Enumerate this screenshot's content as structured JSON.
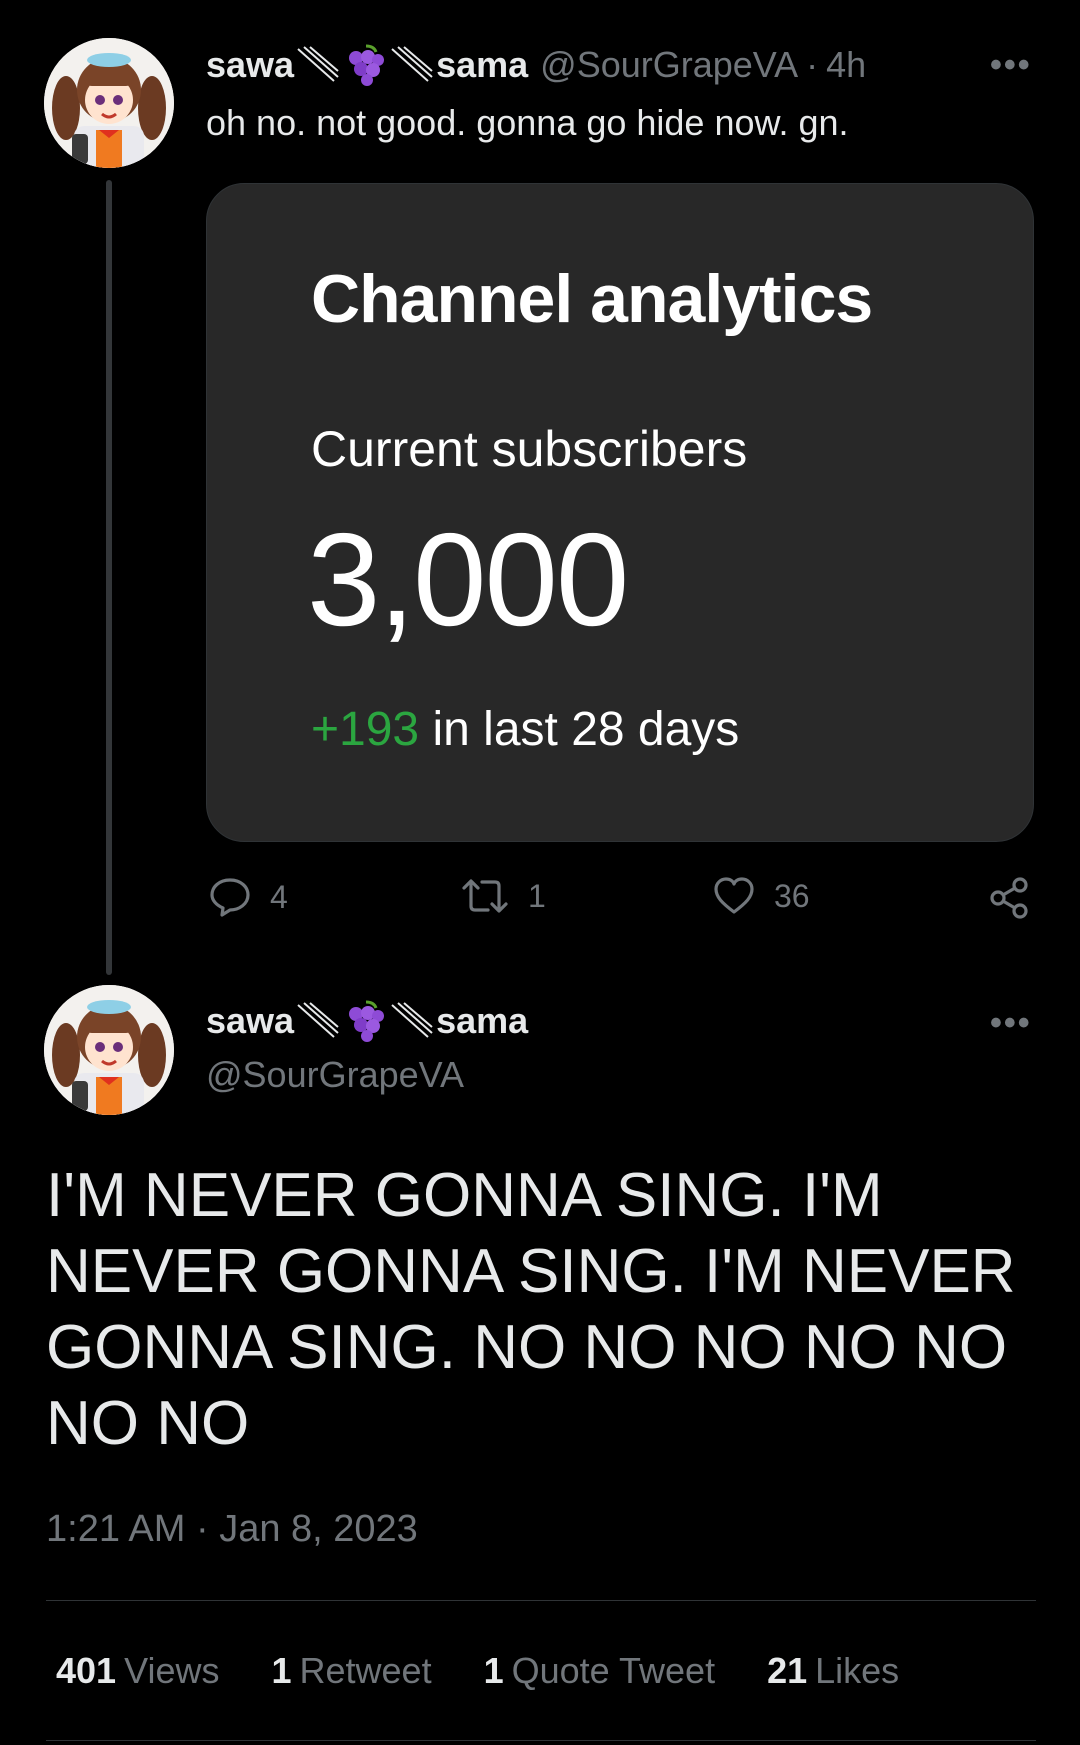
{
  "tweet1": {
    "name_left": "sawa",
    "name_right": "sama",
    "handle": "@SourGrapeVA",
    "separator": "·",
    "time_ago": "4h",
    "more": "•••",
    "text": "oh no. not good. gonna go hide now. gn.",
    "media": {
      "title": "Channel analytics",
      "subtitle": "Current subscribers",
      "count": "3,000",
      "delta": "+193",
      "delta_suffix": " in last 28 days"
    },
    "actions": {
      "replies": "4",
      "retweets": "1",
      "likes": "36"
    }
  },
  "tweet2": {
    "name_left": "sawa",
    "name_right": "sama",
    "handle": "@SourGrapeVA",
    "more": "•••",
    "text": "I'M NEVER GONNA SING. I'M NEVER GONNA SING. I'M NEVER GONNA SING. NO NO NO NO NO NO NO",
    "timestamp": "1:21 AM · Jan 8, 2023",
    "stats": [
      {
        "num": "401",
        "label": "Views"
      },
      {
        "num": "1",
        "label": "Retweet"
      },
      {
        "num": "1",
        "label": "Quote Tweet"
      },
      {
        "num": "21",
        "label": "Likes"
      }
    ]
  },
  "colors": {
    "background": "#000000",
    "text": "#e7e9ea",
    "muted": "#71767b",
    "grape": "#8e4bd6",
    "positive": "#2ba640"
  },
  "icons": [
    "reply-icon",
    "retweet-icon",
    "like-icon",
    "share-icon",
    "grape-emoji-icon",
    "avatar"
  ]
}
